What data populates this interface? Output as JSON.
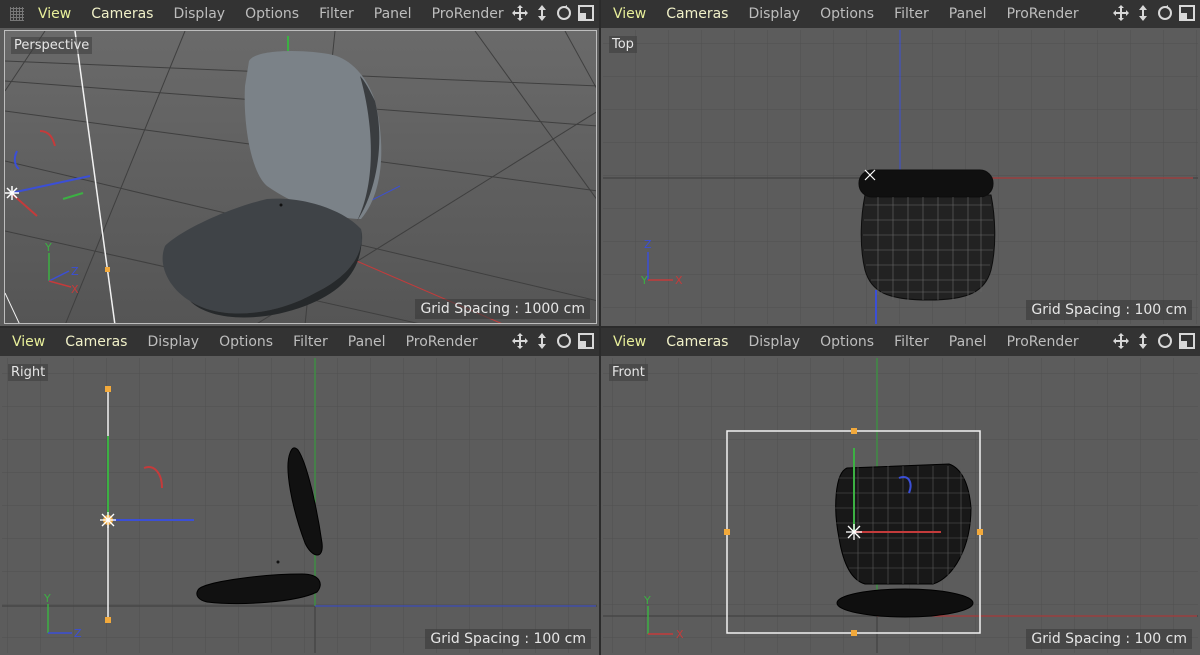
{
  "menu": {
    "view": "View",
    "cameras": "Cameras",
    "display": "Display",
    "options": "Options",
    "filter": "Filter",
    "panel": "Panel",
    "prorender": "ProRender"
  },
  "nav_icons": [
    "move-icon",
    "dolly-icon",
    "rotate-icon",
    "maximize-icon"
  ],
  "viewports": {
    "perspective": {
      "label": "Perspective",
      "grid": "Grid Spacing : 1000 cm"
    },
    "top": {
      "label": "Top",
      "grid": "Grid Spacing : 100 cm"
    },
    "right": {
      "label": "Right",
      "grid": "Grid Spacing : 100 cm"
    },
    "front": {
      "label": "Front",
      "grid": "Grid Spacing : 100 cm"
    }
  },
  "axis_labels": {
    "x": "X",
    "y": "Y",
    "z": "Z"
  },
  "colors": {
    "menu_highlight": "#e8ef9a",
    "axis_x": "#c43b3b",
    "axis_y": "#3cb043",
    "axis_z": "#3b4fd6",
    "handle": "#f2a93b"
  }
}
